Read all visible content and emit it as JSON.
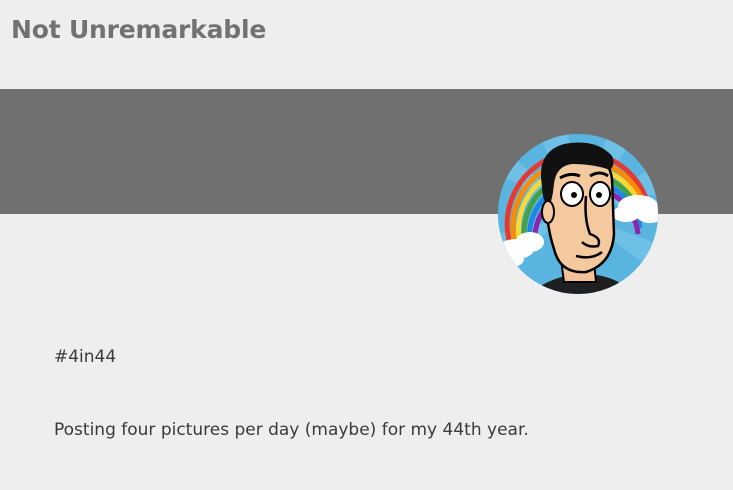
{
  "site": {
    "title": "Not Unremarkable"
  },
  "profile": {
    "avatar_icon": "cartoon-face-rainbow-avatar"
  },
  "bio": {
    "hashtag": "#4in44",
    "description": "Posting four pictures per day (maybe) for my 44th year."
  },
  "colors": {
    "background": "#eeeeee",
    "banner": "#707070",
    "title": "#727272",
    "body_text": "#3a3a3a",
    "avatar_sky": "#5ab4e0"
  }
}
